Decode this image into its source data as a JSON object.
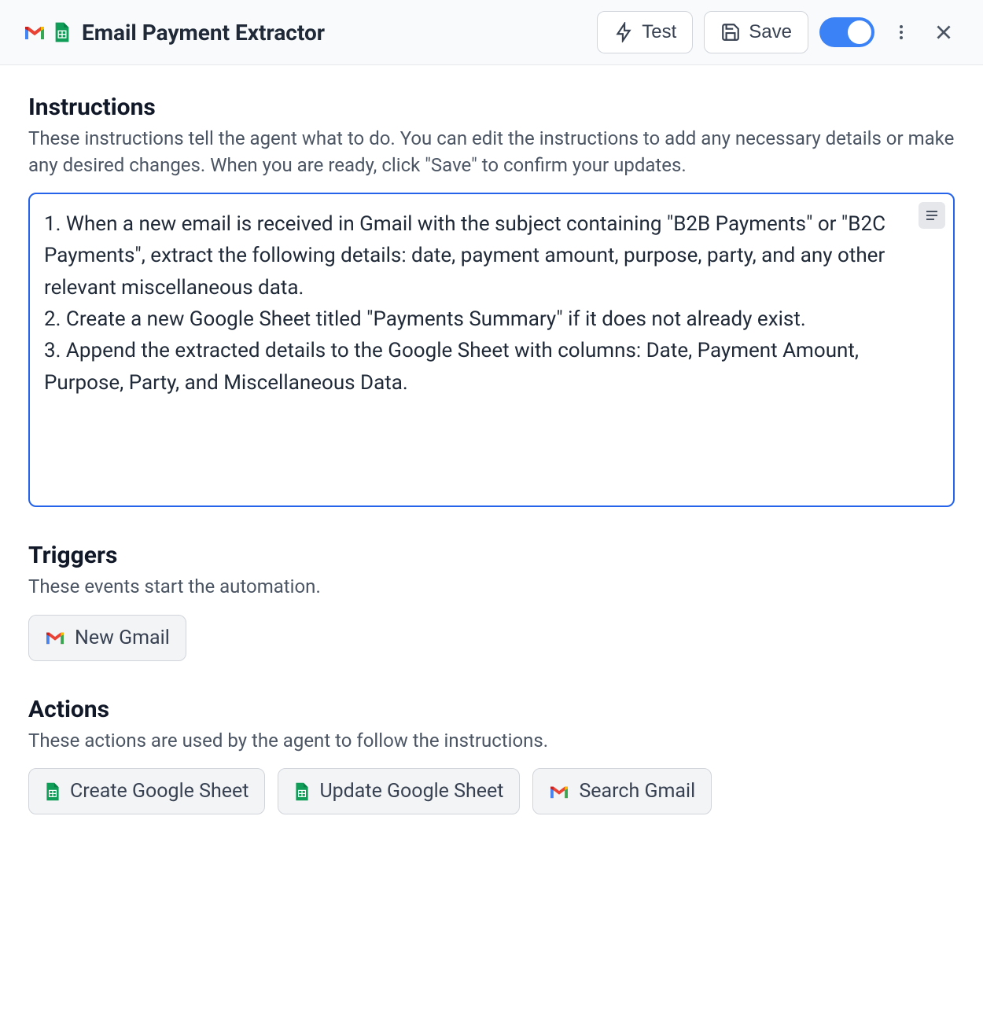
{
  "header": {
    "title": "Email Payment Extractor",
    "test_label": "Test",
    "save_label": "Save",
    "toggle_on": true
  },
  "instructions": {
    "heading": "Instructions",
    "description": "These instructions tell the agent what to do. You can edit the instructions to add any necessary details or make any desired changes. When you are ready, click \"Save\" to confirm your updates.",
    "content": "1. When a new email is received in Gmail with the subject containing \"B2B Payments\" or \"B2C Payments\", extract the following details: date, payment amount, purpose, party, and any other relevant miscellaneous data.\n2. Create a new Google Sheet titled \"Payments Summary\" if it does not already exist.\n3. Append the extracted details to the Google Sheet with columns: Date, Payment Amount, Purpose, Party, and Miscellaneous Data."
  },
  "triggers": {
    "heading": "Triggers",
    "description": "These events start the automation.",
    "items": [
      {
        "icon": "gmail",
        "label": "New Gmail"
      }
    ]
  },
  "actions": {
    "heading": "Actions",
    "description": "These actions are used by the agent to follow the instructions.",
    "items": [
      {
        "icon": "sheets",
        "label": "Create Google Sheet"
      },
      {
        "icon": "sheets",
        "label": "Update Google Sheet"
      },
      {
        "icon": "gmail",
        "label": "Search Gmail"
      }
    ]
  }
}
